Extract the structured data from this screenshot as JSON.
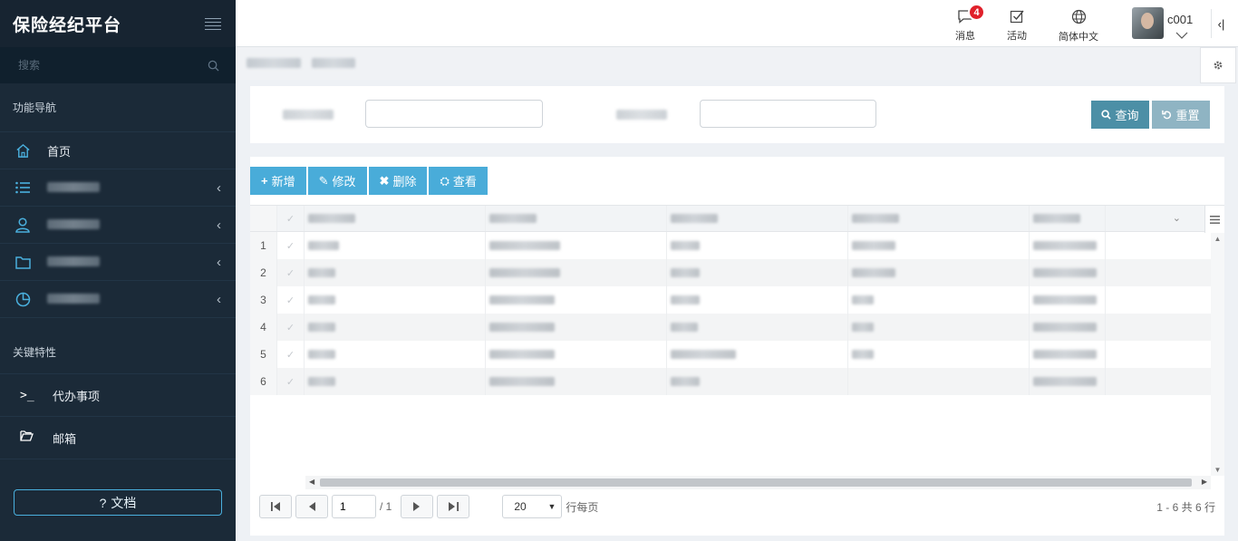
{
  "sidebar": {
    "brand": "保险经纪平台",
    "search_placeholder": "搜索",
    "section_nav": "功能导航",
    "nav_items": [
      {
        "icon": "home-icon",
        "label": "首页"
      },
      {
        "icon": "list-icon",
        "label": ""
      },
      {
        "icon": "user-icon",
        "label": ""
      },
      {
        "icon": "folder-icon",
        "label": ""
      },
      {
        "icon": "pie-chart-icon",
        "label": ""
      }
    ],
    "section_key": "关键特性",
    "key_items": [
      {
        "icon": "terminal-icon",
        "label": "代办事项"
      },
      {
        "icon": "folder-open-icon",
        "label": "邮箱"
      }
    ],
    "doc_button": "文档",
    "doc_icon": "?"
  },
  "topbar": {
    "messages_label": "消息",
    "messages_badge": "4",
    "activity_label": "活动",
    "language_label": "简体中文",
    "user_name": "c001",
    "collapse_glyph": "‹|"
  },
  "search": {
    "query_button": "查询",
    "reset_button": "重置"
  },
  "toolbar": {
    "add": "新增",
    "edit": "修改",
    "delete": "删除",
    "view": "查看"
  },
  "grid": {
    "rows": [
      "1",
      "2",
      "3",
      "4",
      "5",
      "6"
    ],
    "columns_count": 5
  },
  "pager": {
    "page": "1",
    "total_pages": "1",
    "page_size": "20",
    "per_page_label": "行每页",
    "info": "1 - 6 共 6 行"
  },
  "colors": {
    "sidebar_bg": "#1b2a38",
    "accent": "#49acd9",
    "query_button": "#4c8fa6",
    "badge": "#e0202a"
  }
}
